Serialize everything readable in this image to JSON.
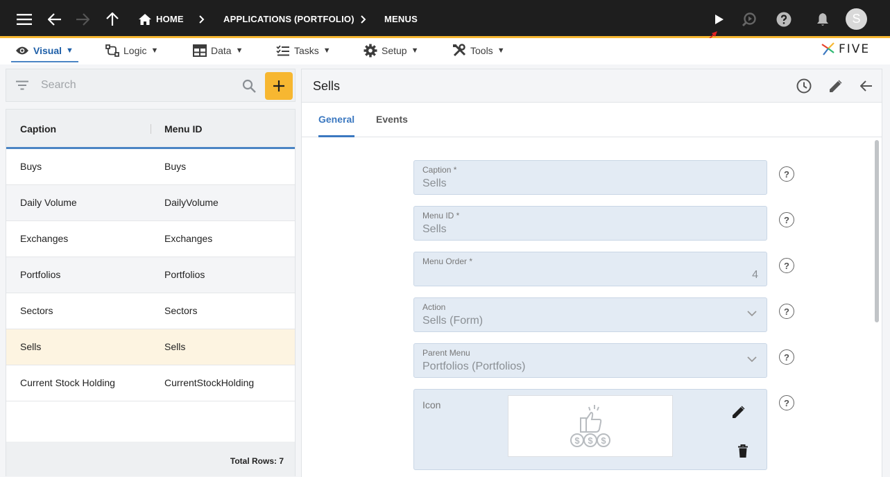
{
  "topbar": {
    "breadcrumb": [
      "HOME",
      "APPLICATIONS (PORTFOLIO)",
      "MENUS"
    ],
    "avatar_initial": "S"
  },
  "menubar": {
    "items": [
      {
        "label": "Visual"
      },
      {
        "label": "Logic"
      },
      {
        "label": "Data"
      },
      {
        "label": "Tasks"
      },
      {
        "label": "Setup"
      },
      {
        "label": "Tools"
      }
    ],
    "logo": "FIVE"
  },
  "search": {
    "placeholder": "Search"
  },
  "list": {
    "columns": [
      "Caption",
      "Menu ID"
    ],
    "rows": [
      {
        "caption": "Buys",
        "menu_id": "Buys"
      },
      {
        "caption": "Daily Volume",
        "menu_id": "DailyVolume"
      },
      {
        "caption": "Exchanges",
        "menu_id": "Exchanges"
      },
      {
        "caption": "Portfolios",
        "menu_id": "Portfolios"
      },
      {
        "caption": "Sectors",
        "menu_id": "Sectors"
      },
      {
        "caption": "Sells",
        "menu_id": "Sells"
      },
      {
        "caption": "Current Stock Holding",
        "menu_id": "CurrentStockHolding"
      }
    ],
    "selected_index": 5,
    "footer": "Total Rows: 7"
  },
  "detail": {
    "title": "Sells",
    "tabs": [
      "General",
      "Events"
    ],
    "fields": [
      {
        "label": "Caption *",
        "value": "Sells"
      },
      {
        "label": "Menu ID *",
        "value": "Sells"
      },
      {
        "label": "Menu Order *",
        "value": "4"
      },
      {
        "label": "Action",
        "value": "Sells (Form)"
      },
      {
        "label": "Parent Menu",
        "value": "Portfolios (Portfolios)"
      },
      {
        "label": "Icon",
        "value": ""
      }
    ]
  },
  "colors": {
    "accent": "#f7b731",
    "topbar": "#1e1e1e",
    "link_blue": "#3b78c0",
    "field_bg": "#e3ebf4"
  }
}
